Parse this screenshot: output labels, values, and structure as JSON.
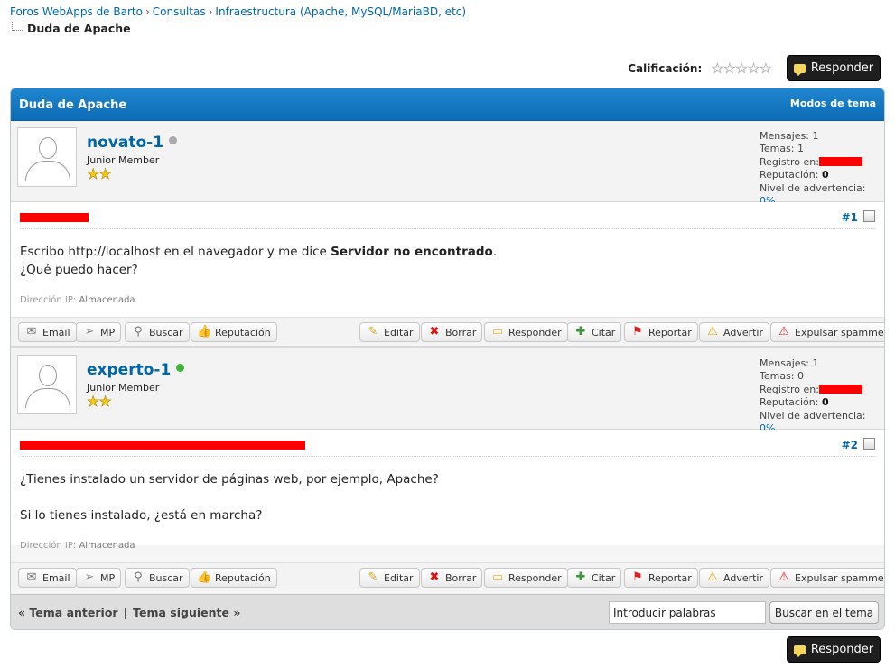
{
  "breadcrumb": {
    "items": [
      "Foros WebApps de Barto",
      "Consultas",
      "Infraestructura (Apache, MySQL/MariaBD, etc)"
    ],
    "separator": "›",
    "current": "Duda de Apache"
  },
  "rating": {
    "label": "Calificación:",
    "stars": "☆☆☆☆☆",
    "value": 0
  },
  "reply_button": "Responder",
  "thread": {
    "title": "Duda de Apache",
    "modes": "Modos de tema"
  },
  "posts": [
    {
      "username": "novato-1",
      "online": false,
      "role": "Junior Member",
      "stars": "★★",
      "stats": {
        "mensajes_label": "Mensajes:",
        "mensajes": "1",
        "temas_label": "Temas:",
        "temas": "1",
        "registro_label": "Registro en:",
        "reputacion_label": "Reputación:",
        "reputacion": "0",
        "advertencia_label": "Nivel de advertencia:",
        "advertencia": "0%"
      },
      "number": "#1",
      "text_before": "Escribo http://localhost en el navegador y me dice ",
      "text_bold": "Servidor no encontrado",
      "text_after": ".",
      "text_line2": "¿Qué puedo hacer?",
      "ip_label": "Dirección IP:",
      "ip_value": "Almacenada"
    },
    {
      "username": "experto-1",
      "online": true,
      "role": "Junior Member",
      "stars": "★★",
      "stats": {
        "mensajes_label": "Mensajes:",
        "mensajes": "1",
        "temas_label": "Temas:",
        "temas": "0",
        "registro_label": "Registro en:",
        "reputacion_label": "Reputación:",
        "reputacion": "0",
        "advertencia_label": "Nivel de advertencia:",
        "advertencia": "0%"
      },
      "number": "#2",
      "text_line1": "¿Tienes instalado un servidor de páginas web, por ejemplo, Apache?",
      "text_line2": "Si lo tienes instalado, ¿está en marcha?",
      "ip_label": "Dirección IP:",
      "ip_value": "Almacenada"
    }
  ],
  "post_actions": {
    "email": "Email",
    "mp": "MP",
    "buscar": "Buscar",
    "reputacion": "Reputación",
    "editar": "Editar",
    "borrar": "Borrar",
    "responder": "Responder",
    "citar": "Citar",
    "reportar": "Reportar",
    "advertir": "Advertir",
    "expulsar": "Expulsar spammer"
  },
  "footer": {
    "prev": "« Tema anterior",
    "divider": "|",
    "next": "Tema siguiente »",
    "search_value": "Introducir palabras",
    "search_button": "Buscar en el tema"
  },
  "colors": {
    "header_blue": "#0d6cb5",
    "link": "#0066a8",
    "online": "#3cb83c",
    "offline": "#aaaaaa",
    "redaction": "#ff0000"
  }
}
